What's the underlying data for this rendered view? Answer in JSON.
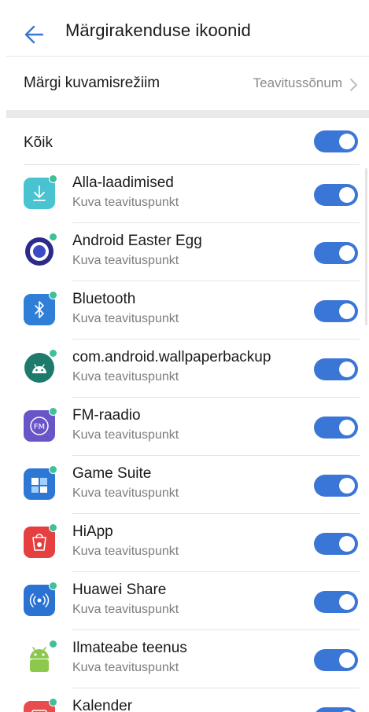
{
  "header": {
    "title": "Märgirakenduse ikoonid"
  },
  "mode": {
    "label": "Märgi kuvamisrežiim",
    "value": "Teavitussõnum"
  },
  "all": {
    "label": "Kõik",
    "enabled": true
  },
  "apps": [
    {
      "name": "Alla-laadimised",
      "sub": "Kuva teavituspunkt",
      "icon": "download-icon",
      "enabled": true
    },
    {
      "name": "Android Easter Egg",
      "sub": "Kuva teavituspunkt",
      "icon": "easter-egg-icon",
      "enabled": true
    },
    {
      "name": "Bluetooth",
      "sub": "Kuva teavituspunkt",
      "icon": "bluetooth-icon",
      "enabled": true
    },
    {
      "name": "com.android.wallpaperbackup",
      "sub": "Kuva teavituspunkt",
      "icon": "android-icon",
      "enabled": true
    },
    {
      "name": "FM-raadio",
      "sub": "Kuva teavituspunkt",
      "icon": "fm-radio-icon",
      "enabled": true
    },
    {
      "name": "Game Suite",
      "sub": "Kuva teavituspunkt",
      "icon": "game-suite-icon",
      "enabled": true
    },
    {
      "name": "HiApp",
      "sub": "Kuva teavituspunkt",
      "icon": "hiapp-icon",
      "enabled": true
    },
    {
      "name": "Huawei Share",
      "sub": "Kuva teavituspunkt",
      "icon": "huawei-share-icon",
      "enabled": true
    },
    {
      "name": "Ilmateabe teenus",
      "sub": "Kuva teavituspunkt",
      "icon": "weather-service-icon",
      "enabled": true
    },
    {
      "name": "Kalender",
      "sub": "",
      "icon": "calendar-icon",
      "enabled": true
    }
  ],
  "colors": {
    "accent": "#3a76d6",
    "badge_dot": "#3fbf9b",
    "secondary_text": "#7d7d7d"
  }
}
